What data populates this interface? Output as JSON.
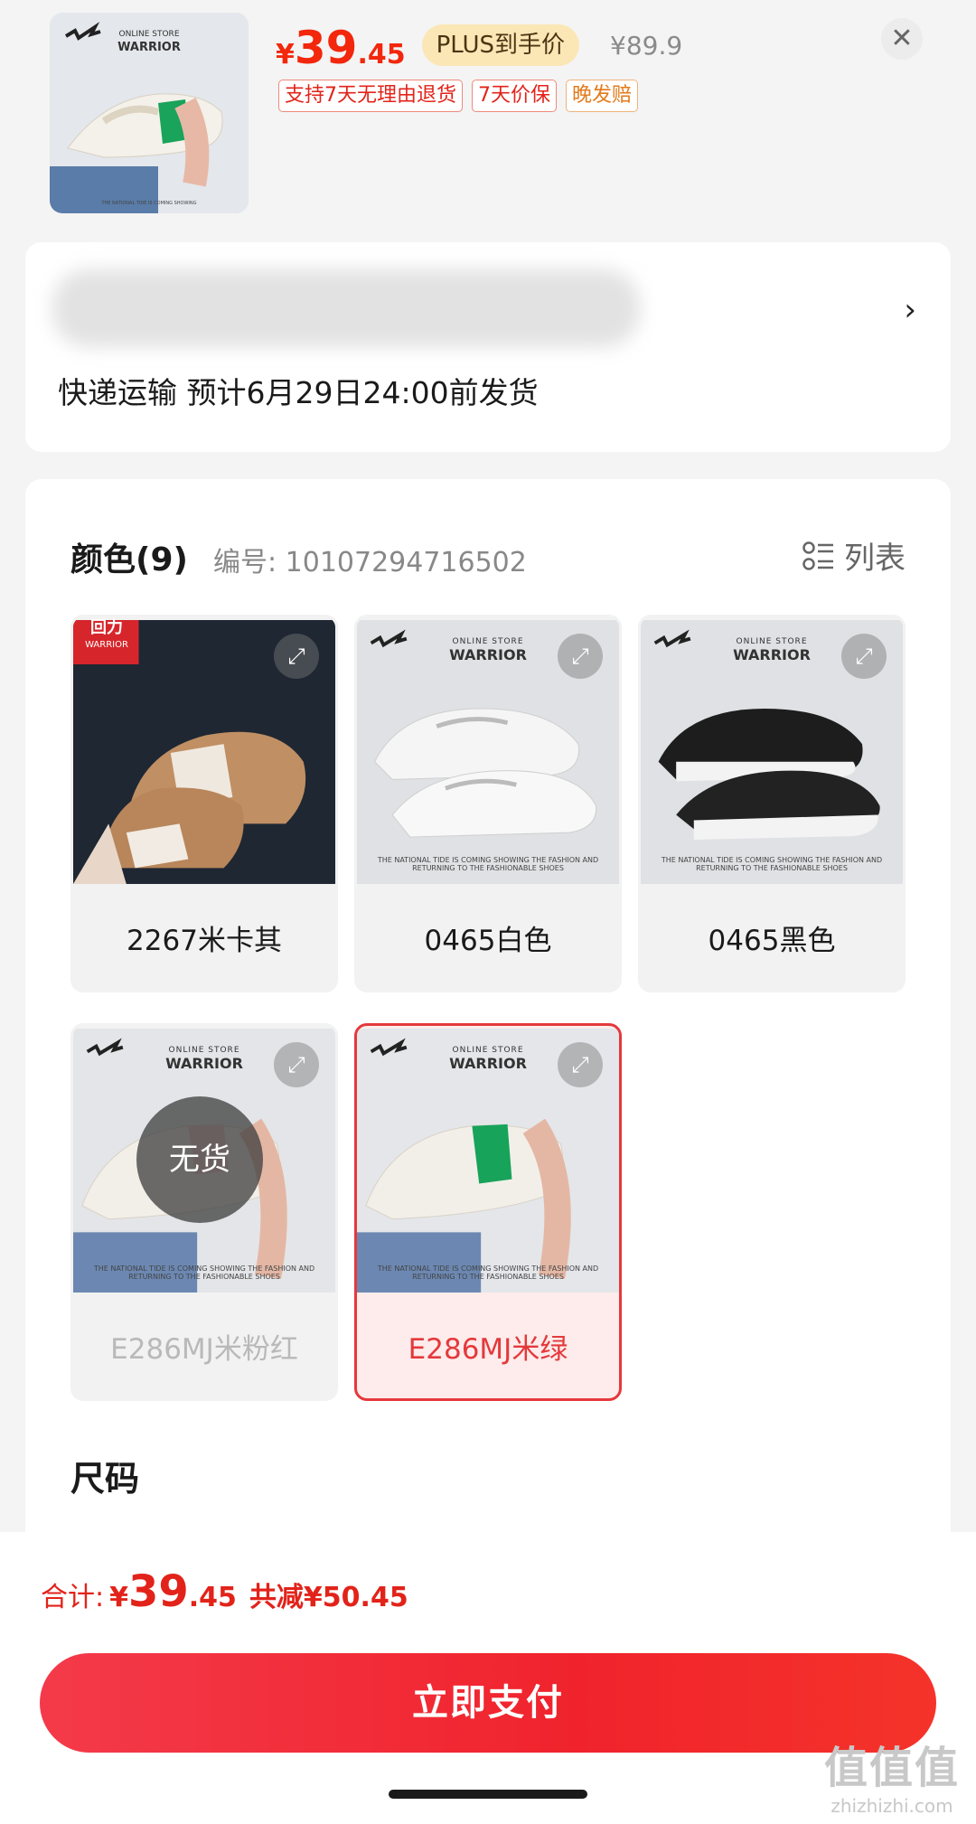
{
  "header": {
    "price": {
      "currency": "¥",
      "int": "39",
      "dec": ".45"
    },
    "plus_tag": "PLUS到手价",
    "original_price": "¥89.9",
    "tags": [
      "支持7天无理由退货",
      "7天价保",
      "晚发赔"
    ],
    "close_icon": "close-icon"
  },
  "address": {
    "delivery": "快递运输 预计6月29日24:00前发货"
  },
  "spec": {
    "color_title": "颜色(9)",
    "sku": "编号: 10107294716502",
    "list_label": "列表",
    "brand": {
      "small": "ONLINE STORE",
      "name": "WARRIOR",
      "caption": "THE NATIONAL TIDE IS COMING SHOWING THE FASHION AND RETURNING TO THE FASHIONABLE SHOES"
    },
    "options": [
      {
        "label": "2267米卡其",
        "state": "normal"
      },
      {
        "label": "0465白色",
        "state": "normal"
      },
      {
        "label": "0465黑色",
        "state": "normal"
      },
      {
        "label": "E286MJ米粉红",
        "state": "disabled",
        "badge": "无货"
      },
      {
        "label": "E286MJ米绿",
        "state": "selected"
      }
    ],
    "logo_text": {
      "cn": "回力",
      "en": "WARRIOR"
    },
    "size_title": "尺码"
  },
  "footer": {
    "total_label": "合计:",
    "total": {
      "currency": "¥",
      "int": "39",
      "dec": ".45"
    },
    "saving": "共减¥50.45",
    "pay_button": "立即支付"
  },
  "watermark": {
    "main": "值值值",
    "url": "zhizhizhi.com"
  },
  "colors": {
    "accent": "#e4393c",
    "price": "#f2270c",
    "plus_bg": "#fbe7b6"
  }
}
